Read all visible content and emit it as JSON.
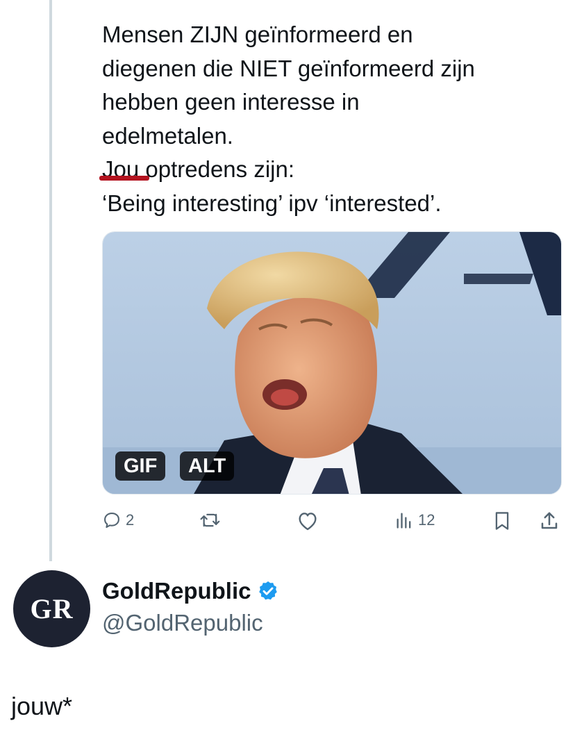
{
  "tweet": {
    "text_lines": [
      "Mensen ZIJN geïnformeerd en",
      "diegenen die NIET geïnformeerd zijn",
      "hebben geen interesse in",
      "edelmetalen.",
      "Jou optredens zijn:",
      "‘Being interesting’ ipv ‘interested’."
    ],
    "media": {
      "gif_badge": "GIF",
      "alt_badge": "ALT"
    },
    "actions": {
      "replies": "2",
      "views": "12",
      "reply_icon": "reply-icon",
      "retweet_icon": "retweet-icon",
      "like_icon": "heart-icon",
      "views_icon": "views-chart-icon",
      "bookmark_icon": "bookmark-icon",
      "share_icon": "share-icon"
    }
  },
  "reply": {
    "avatar_initials": "GR",
    "author_name": "GoldRepublic",
    "author_handle": "@GoldRepublic",
    "verified": true,
    "text": "jouw*"
  },
  "colors": {
    "verified_blue": "#1d9bf0",
    "spellcheck_red": "#b3121f",
    "thread_line": "#cfd9de",
    "muted": "#536471"
  }
}
